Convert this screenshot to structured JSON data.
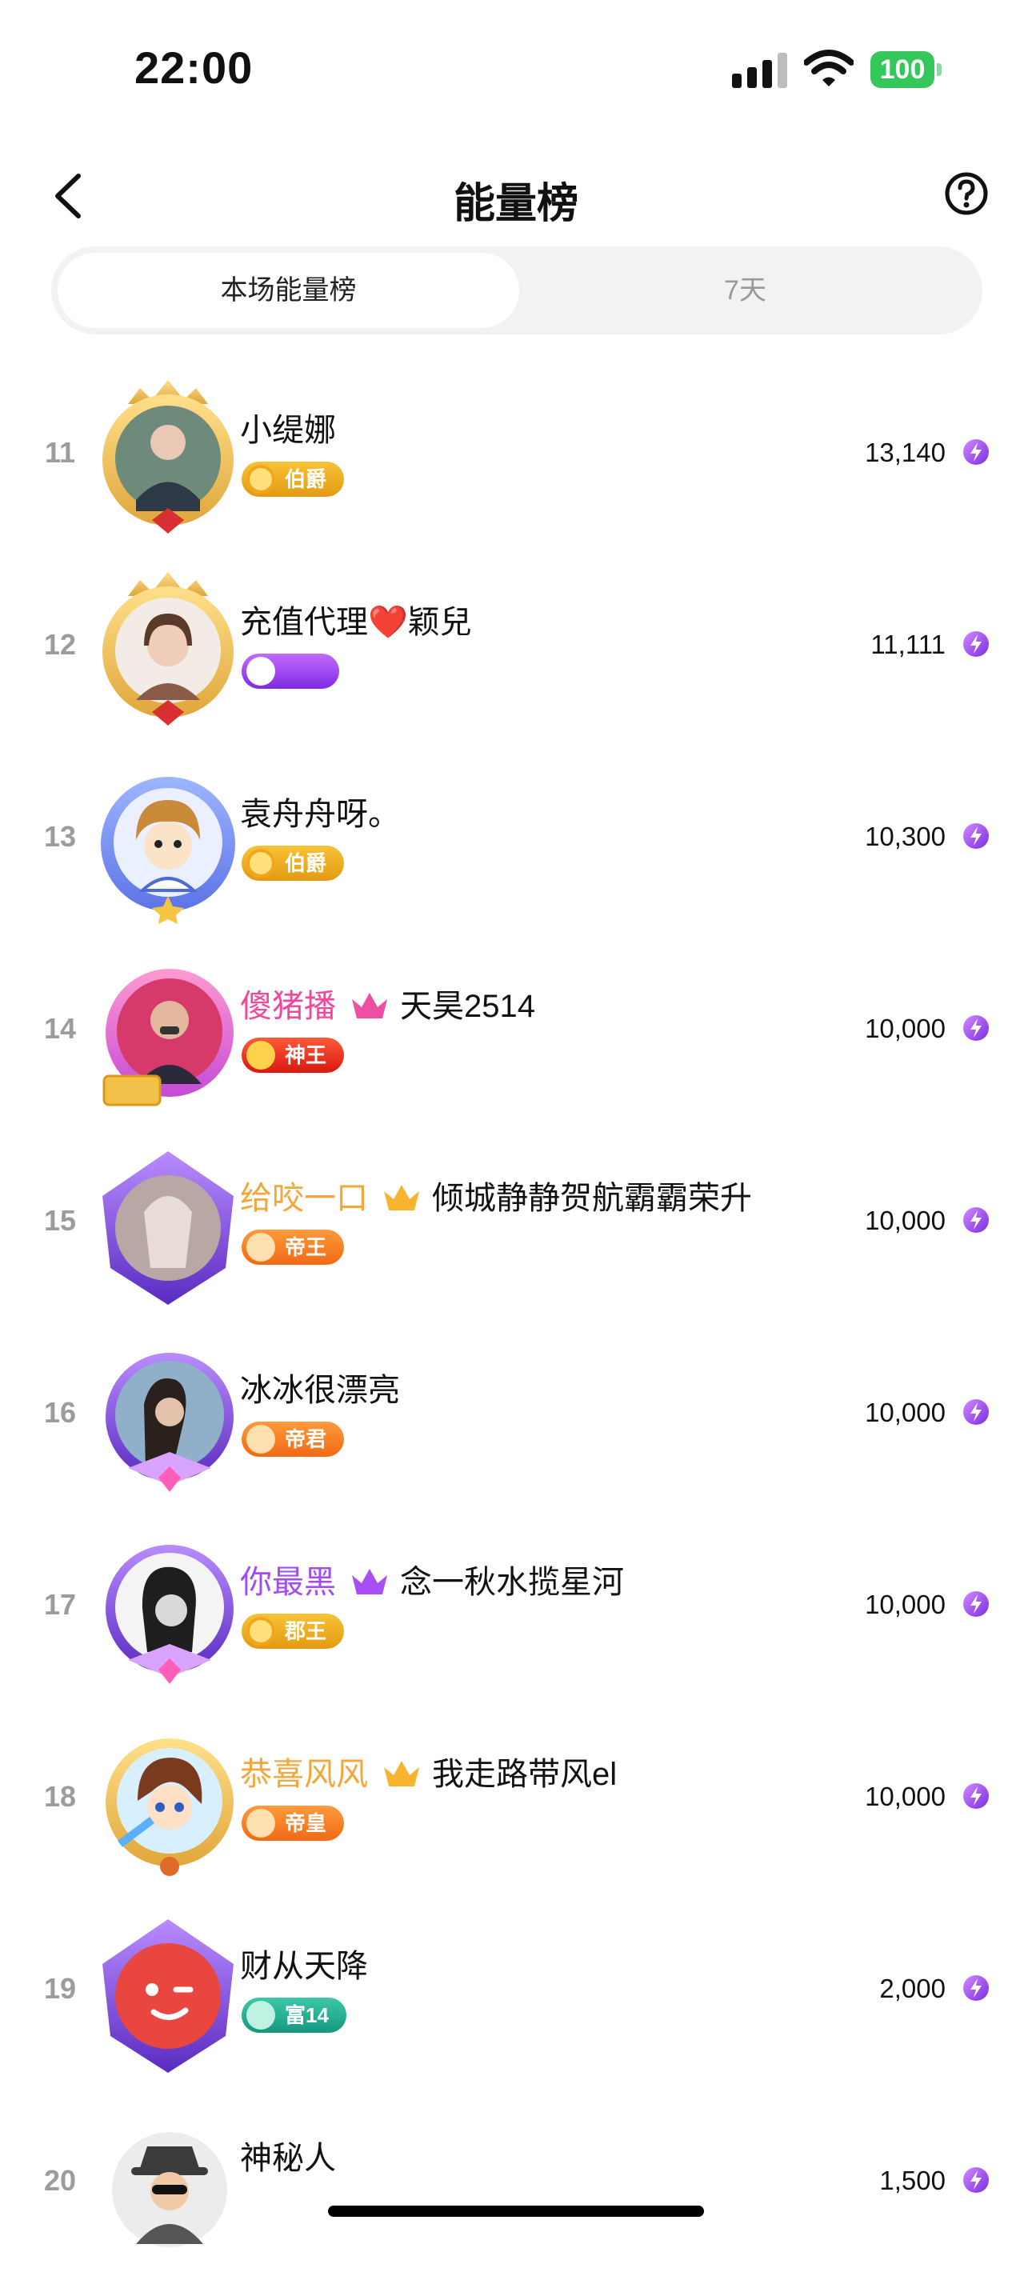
{
  "status_bar": {
    "time": "22:00",
    "battery": "100"
  },
  "header": {
    "title": "能量榜"
  },
  "tabs": [
    {
      "label": "本场能量榜",
      "active": true
    },
    {
      "label": "7天",
      "active": false
    }
  ],
  "colors": {
    "accent_green": "#34c759",
    "rank_gray": "#9c9c9c"
  },
  "rows": [
    {
      "rank": "11",
      "name": "小缇娜",
      "badge": "伯爵",
      "score": "13,140"
    },
    {
      "rank": "12",
      "name": "充值代理❤️颖兒",
      "badge": "",
      "score": "11,111"
    },
    {
      "rank": "13",
      "name": "袁舟舟呀。",
      "badge": "伯爵",
      "score": "10,300"
    },
    {
      "rank": "14",
      "prefix": "傻猪播",
      "name": "天昊2514",
      "badge": "神王",
      "score": "10,000"
    },
    {
      "rank": "15",
      "prefix": "给咬一口",
      "name": "倾城静静贺航霸霸荣升",
      "badge": "帝王",
      "score": "10,000"
    },
    {
      "rank": "16",
      "name": "冰冰很漂亮",
      "badge": "帝君",
      "score": "10,000"
    },
    {
      "rank": "17",
      "prefix": "你最黑",
      "name": "念一秋水揽星河",
      "badge": "郡王",
      "score": "10,000"
    },
    {
      "rank": "18",
      "prefix": "恭喜风风",
      "name": "我走路带风el",
      "badge": "帝皇",
      "score": "10,000"
    },
    {
      "rank": "19",
      "name": "财从天降",
      "badge": "富14",
      "score": "2,000"
    },
    {
      "rank": "20",
      "name": "神秘人",
      "badge": "",
      "score": "1,500"
    }
  ]
}
